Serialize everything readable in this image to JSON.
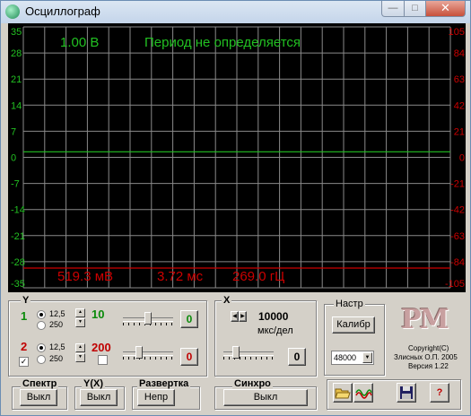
{
  "window": {
    "title": "Осциллограф"
  },
  "titlebar": {
    "minimize": "—",
    "maximize": "□",
    "close": "✕"
  },
  "scope": {
    "y_ticks_left": [
      "35",
      "28",
      "21",
      "14",
      "7",
      "0",
      "-7",
      "-14",
      "-21",
      "-28",
      "-35"
    ],
    "y_ticks_right": [
      "105",
      "84",
      "63",
      "42",
      "21",
      "0",
      "-21",
      "-42",
      "-63",
      "-84",
      "-105"
    ],
    "top_left_label": "1.00 В",
    "top_status": "Период не определяется",
    "measurements": {
      "amplitude": "519.3 мВ",
      "period": "3.72 мс",
      "frequency": "269.0 гЦ"
    },
    "colors": {
      "grid": "#8a8a8a",
      "trace": "#22c022",
      "reference": "#cc0000",
      "left_axis": "#22c022",
      "right_axis": "#cc0000"
    },
    "chart_data": {
      "type": "line",
      "ylim_left": [
        -35,
        35
      ],
      "ylim_right": [
        -105,
        105
      ],
      "grid": true,
      "series": [
        {
          "values": [
            1.5,
            1.5,
            1.5,
            1.5,
            1.5,
            1.5,
            1.5,
            1.5,
            1.5,
            1.5,
            1.5
          ]
        }
      ],
      "reference_line_left_value": -29.7
    }
  },
  "y_section": {
    "title": "Y",
    "ch1": {
      "label": "1",
      "opt_a": "12,5",
      "opt_b": "250",
      "gain": "10",
      "offset_btn": "0"
    },
    "ch2": {
      "label": "2",
      "opt_a": "12,5",
      "opt_b": "250",
      "gain": "200",
      "offset_btn": "0",
      "enabled_check": "✓"
    }
  },
  "x_section": {
    "title": "X",
    "value": "10000",
    "unit": "мкс/дел",
    "offset_btn": "0"
  },
  "nastr": {
    "title": "Настр",
    "calib_btn": "Калибр",
    "rate": "48000"
  },
  "about": {
    "logo": "PM",
    "line1": "Copyright(C)",
    "line2": "Злисных О.П. 2005",
    "line3": "Версия 1.22"
  },
  "bottom": {
    "spectrum": {
      "title": "Спектр",
      "btn": "Выкл"
    },
    "yx": {
      "title": "Y(X)",
      "btn": "Выкл"
    },
    "sweep": {
      "title": "Развертка",
      "btn": "Непр"
    },
    "sync": {
      "title": "Синхро",
      "btn": "Выкл"
    },
    "help_btn": "?"
  }
}
